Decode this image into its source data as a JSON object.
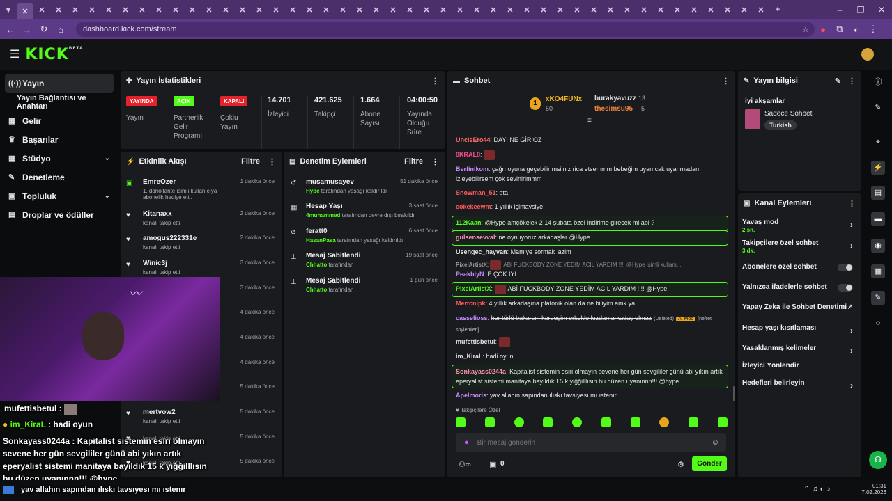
{
  "browser": {
    "url": "dashboard.kick.com/stream",
    "clock_time": "01:31",
    "clock_date": "7.02.2026"
  },
  "nav": {
    "items": [
      {
        "label": "Yayın",
        "icon": "signal-icon"
      },
      {
        "label": "Yayın Bağlantısı ve Anahtarı",
        "icon": ""
      },
      {
        "label": "Gelir",
        "icon": "chart-icon"
      },
      {
        "label": "Başarılar",
        "icon": "trophy-icon"
      },
      {
        "label": "Stüdyo",
        "icon": "grid-icon"
      },
      {
        "label": "Denetleme",
        "icon": "wrench-icon"
      },
      {
        "label": "Topluluk",
        "icon": "people-icon"
      },
      {
        "label": "Droplar ve ödüller",
        "icon": "gift-icon"
      }
    ]
  },
  "stats": {
    "title": "Yayın İstatistikleri",
    "live_badge": "YAYINDA",
    "live_label": "Yayın",
    "partner_badge": "AÇIK",
    "partner_label": "Partnerlik Gelir Programı",
    "multi_badge": "KAPALI",
    "multi_label": "Çoklu Yayın",
    "viewers": "14.701",
    "viewers_label": "İzleyici",
    "followers": "421.625",
    "followers_label": "Takipçi",
    "subs": "1.664",
    "subs_label": "Abone Sayısı",
    "uptime": "04:00:50",
    "uptime_label": "Yayında Olduğu Süre"
  },
  "activity": {
    "title": "Etkinlik Akışı",
    "filter": "Filtre",
    "rows": [
      {
        "name": "EmreOzer",
        "sub": "1, ddrxxfante isimli kullanıcıya abonelik hediye etti.",
        "time": "1 dakika önce"
      },
      {
        "name": "Kitanaxx",
        "sub": "kanalı takip etti",
        "time": "2 dakika önce"
      },
      {
        "name": "amogus222331e",
        "sub": "kanalı takip etti",
        "time": "2 dakika önce"
      },
      {
        "name": "Winic3j",
        "sub": "kanalı takip etti",
        "time": "3 dakika önce"
      },
      {
        "name": "",
        "sub": "",
        "time": "3 dakika önce"
      },
      {
        "name": "",
        "sub": "",
        "time": "4 dakika önce"
      },
      {
        "name": "",
        "sub": "",
        "time": "4 dakika önce"
      },
      {
        "name": "",
        "sub": "",
        "time": "4 dakika önce"
      },
      {
        "name": "",
        "sub": "",
        "time": "5 dakika önce"
      },
      {
        "name": "mertvow2",
        "sub": "kanalı takip etti",
        "time": "5 dakika önce"
      },
      {
        "name": "",
        "sub": "kanalı takip etti",
        "time": "5 dakika önce"
      },
      {
        "name": "",
        "sub": "kanalı takip etti",
        "time": "5 dakika önce"
      }
    ]
  },
  "moderation": {
    "title": "Denetim Eylemleri",
    "filter": "Filtre",
    "rows": [
      {
        "name": "musamusayev",
        "by": "Hype",
        "sub": " tarafından yasağı kaldırıldı",
        "time": "51 dakika önce"
      },
      {
        "name": "Hesap Yaşı",
        "by": "4muhammed",
        "sub": " tarafından devre dışı bırakıldı",
        "time": "3 saat önce"
      },
      {
        "name": "feratt0",
        "by": "HasanPasa",
        "sub": " tarafından yasağı kaldırıldı",
        "time": "6 saat önce"
      },
      {
        "name": "Mesaj Sabitlendi",
        "by": "Chhatto",
        "sub": " tarafından",
        "time": "19 saat önce"
      },
      {
        "name": "Mesaj Sabitlendi",
        "by": "Chhatto",
        "sub": " tarafından",
        "time": "1 gün önce"
      }
    ]
  },
  "chat": {
    "title": "Sohbet",
    "top1": {
      "name": "xKO4FUNx",
      "count": "50"
    },
    "top2": {
      "name": "burakyavuzz",
      "count": "13"
    },
    "top3": {
      "name": "thesimsu95",
      "count": "5"
    },
    "messages": [
      {
        "user": "UncleEro44",
        "color": "#ff6b6b",
        "text": "DAYI NE GİRİOZ"
      },
      {
        "user": "8KRAL8",
        "color": "#ff4d8a",
        "text": ""
      },
      {
        "user": "Berfinikom",
        "color": "#c58bff",
        "text": "çağrı oyuna geçebilir msiiniz rica etsemmm bebeğim uyanıcak uyanmadan izleyebilirsem çok sevinirimmm"
      },
      {
        "user": "Snowman_51",
        "color": "#ff5a5a",
        "text": "gta"
      },
      {
        "user": "cokekeewm",
        "color": "#ff5a5a",
        "text": "1 yıllık içintavsiye"
      },
      {
        "user": "112Kaan",
        "color": "#53fc18",
        "text": "@Hype amçökelek 2 14 şubata özel indirime girecek mi abi ?"
      },
      {
        "user": "gulsensevval",
        "color": "#ff8fb8",
        "text": "ne oynuyoruz arkadaşlar @Hype"
      },
      {
        "user": "Usengec_hayvan",
        "color": "#e0e0e0",
        "text": "Mamiye sormak lazim"
      },
      {
        "user": "PixelArtistX",
        "color": "#9a9a9a",
        "text": "ABİ FUCKBODY ZONE YEDİM ACİL YARDIM !!!! @Hype isimli kullanı..."
      },
      {
        "user": "PeakbIyN",
        "color": "#c58bff",
        "text": "E ÇOK İYİ"
      },
      {
        "user": "PixelArtistX",
        "color": "#53fc18",
        "text": "ABİ FUCKBODY ZONE YEDİM ACİL YARDIM !!!! @Hype"
      },
      {
        "user": "Mertcnipk",
        "color": "#ff5a5a",
        "text": "4 yıllık arkadaşına platonik olan da ne biliyim amk ya"
      },
      {
        "user": "casselioss",
        "color": "#c58bff",
        "text": "her türlü bakarsın kardeşim erkekle kızdan arkadaş olmaz",
        "deleted": "(Deleted)",
        "mod": "AI Mod",
        "reason": "[nefret söylemleri]"
      },
      {
        "user": "mufettisbetul",
        "color": "#e0e0e0",
        "text": ""
      },
      {
        "user": "im_KiraL",
        "color": "#e0e0e0",
        "text": "hadi oyun"
      },
      {
        "user": "Sonkayass0244a",
        "color": "#ff8fb8",
        "text": "Kapitalist sistemin esiri olmayın sevene her gün sevgililer günü abi yıkın artık eperyalist sistemi manitaya bayıldık 15 k yiğğilllısın bu düzen uyanınnn!!! @hype"
      },
      {
        "user": "Apelmoris",
        "color": "#c58bff",
        "text": "yav allahın sapından ılıskı tavsıyesı mı ıstenır"
      }
    ],
    "subs_only_label": "Takipçilere Özel",
    "input_placeholder": "Bir mesaj gönderin",
    "zero_count": "0",
    "send_label": "Gönder"
  },
  "info": {
    "title": "Yayın bilgisi",
    "stream_title": "iyi akşamlar",
    "category": "Sadece Sohbet",
    "tag": "Turkish"
  },
  "actions": {
    "title": "Kanal Eylemleri",
    "items": [
      {
        "label": "Yavaş mod",
        "sub": "2 sn.",
        "type": "chev"
      },
      {
        "label": "Takipçilere özel sohbet",
        "sub": "3 dk.",
        "type": "chev"
      },
      {
        "label": "Abonelere özel sohbet",
        "sub": "",
        "type": "toggle"
      },
      {
        "label": "Yalnızca ifadelerle sohbet",
        "sub": "",
        "type": "toggle"
      },
      {
        "label": "Yapay Zeka ile Sohbet Denetimi",
        "sub": "",
        "type": "ext"
      },
      {
        "label": "Hesap yaşı kısıtlaması",
        "sub": "",
        "type": "chev"
      },
      {
        "label": "Yasaklanmış kelimeler",
        "sub": "",
        "type": "chev"
      },
      {
        "label": "İzleyici Yönlendir",
        "sub": "",
        "type": "none"
      },
      {
        "label": "Hedefleri belirleyin",
        "sub": "",
        "type": "chev"
      }
    ]
  },
  "overlay": {
    "l1": "mufettisbetul :",
    "l2_user": "im_KiraL",
    "l2_text": " : hadi oyun",
    "l3": "Sonkayass0244a : Kapitalist sistemin esiri olmayın sevene her gün sevgililer günü abi yıkın artık eperyalist sistemi manitaya bayıldık 15 k yiğğilllısın bu düzen uyanınnn!!! @hype",
    "l4": "yav allahın sapından ılıskı tavsıyesı mı ıstenır"
  }
}
